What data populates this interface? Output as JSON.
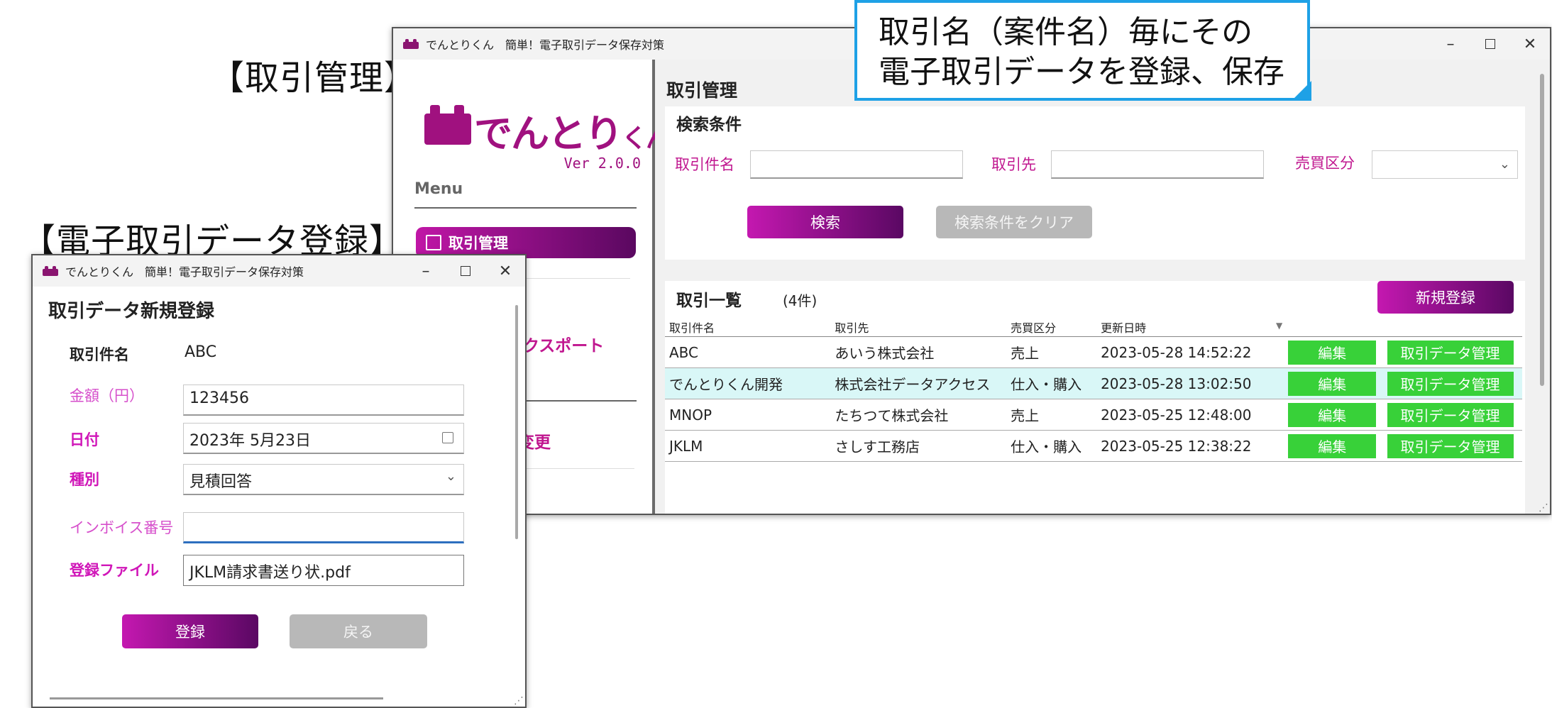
{
  "captions": {
    "main": "【取引管理】",
    "sub": "【電子取引データ登録】"
  },
  "callout": {
    "line1": "取引名（案件名）毎にその",
    "line2": "電子取引データを登録、保存"
  },
  "app": {
    "window_title": "でんとりくん　簡単！電子取引データ保存対策",
    "logo_text": "でんとり",
    "logo_small": "くん",
    "version": "Ver 2.0.0"
  },
  "sidebar": {
    "menu_label": "Menu",
    "items": [
      {
        "label": "取引管理"
      },
      {
        "label": "エクスポート"
      },
      {
        "label": "変更"
      }
    ]
  },
  "main": {
    "page_title": "取引管理",
    "search": {
      "title": "検索条件",
      "deal_name_label": "取引件名",
      "partner_label": "取引先",
      "type_label": "売買区分",
      "search_button": "検索",
      "clear_button": "検索条件をクリア"
    },
    "list": {
      "title": "取引一覧",
      "count": "(4件)",
      "new_button": "新規登録",
      "columns": [
        "取引件名",
        "取引先",
        "売買区分",
        "更新日時"
      ],
      "edit_label": "編集",
      "manage_label": "取引データ管理",
      "rows": [
        {
          "name": "ABC",
          "partner": "あいう株式会社",
          "type": "売上",
          "updated": "2023-05-28 14:52:22"
        },
        {
          "name": "でんとりくん開発",
          "partner": "株式会社データアクセス",
          "type": "仕入・購入",
          "updated": "2023-05-28 13:02:50"
        },
        {
          "name": "MNOP",
          "partner": "たちつて株式会社",
          "type": "売上",
          "updated": "2023-05-25 12:48:00"
        },
        {
          "name": "JKLM",
          "partner": "さしす工務店",
          "type": "仕入・購入",
          "updated": "2023-05-25 12:38:22"
        }
      ]
    }
  },
  "form": {
    "title": "取引データ新規登録",
    "deal_name_label": "取引件名",
    "deal_name_value": "ABC",
    "amount_label": "金額（円）",
    "amount_value": "123456",
    "date_label": "日付",
    "date_value": "2023年  5月23日",
    "kind_label": "種別",
    "kind_value": "見積回答",
    "invoice_label": "インボイス番号",
    "invoice_value": "",
    "file_label": "登録ファイル",
    "file_value": "JKLM請求書送り状.pdf",
    "register_button": "登録",
    "back_button": "戻る"
  },
  "colors": {
    "brand": "#a0117f",
    "accent_pink": "#c0168f",
    "callout_border": "#1ea1e6",
    "green": "#38d139",
    "highlight_row": "#d9f7f7"
  }
}
